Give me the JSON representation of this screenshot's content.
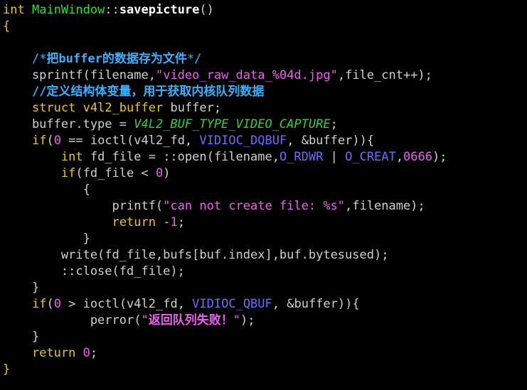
{
  "colors": {
    "background": "#000000",
    "keyword": "#eac32d",
    "function": "#2ee02e",
    "string": "#ee5ef0",
    "macro": "#6d6dff",
    "comment": "#39b1ff",
    "text": "#d0d0d0"
  },
  "code": {
    "lines": [
      [
        {
          "t": "int",
          "c": "kw"
        },
        {
          "t": " ",
          "c": "ident"
        },
        {
          "t": "MainWindow",
          "c": "fn"
        },
        {
          "t": "::",
          "c": "op"
        },
        {
          "t": "savepicture",
          "c": "fnbold"
        },
        {
          "t": "()",
          "c": "punct"
        }
      ],
      [
        {
          "t": "{",
          "c": "kw"
        }
      ],
      [],
      [
        {
          "t": "    ",
          "c": "ident"
        },
        {
          "t": "/*",
          "c": "comment"
        },
        {
          "t": "把buffer的数据存为文件",
          "c": "commentbold"
        },
        {
          "t": "*/",
          "c": "comment"
        }
      ],
      [
        {
          "t": "    sprintf",
          "c": "ident"
        },
        {
          "t": "(",
          "c": "punct"
        },
        {
          "t": "filename,",
          "c": "ident"
        },
        {
          "t": "\"video_raw_data_%04d.jpg\"",
          "c": "str"
        },
        {
          "t": ",file_cnt++);",
          "c": "ident"
        }
      ],
      [
        {
          "t": "    ",
          "c": "ident"
        },
        {
          "t": "//定义结构体变量，用于获取内核队列数据",
          "c": "commentbold"
        }
      ],
      [
        {
          "t": "    ",
          "c": "ident"
        },
        {
          "t": "struct",
          "c": "kw"
        },
        {
          "t": " ",
          "c": "ident"
        },
        {
          "t": "v4l2_buffer",
          "c": "kw"
        },
        {
          "t": " buffer;",
          "c": "ident"
        }
      ],
      [
        {
          "t": "    buffer.type = ",
          "c": "ident"
        },
        {
          "t": "V4L2_BUF_TYPE_VIDEO_CAPTURE",
          "c": "macro2"
        },
        {
          "t": ";",
          "c": "ident"
        }
      ],
      [
        {
          "t": "    ",
          "c": "ident"
        },
        {
          "t": "if",
          "c": "kw"
        },
        {
          "t": "(",
          "c": "punct"
        },
        {
          "t": "0",
          "c": "num"
        },
        {
          "t": " == ioctl(v4l2_fd, ",
          "c": "ident"
        },
        {
          "t": "VIDIOC_DQBUF",
          "c": "macro"
        },
        {
          "t": ", &buffer)){",
          "c": "ident"
        }
      ],
      [
        {
          "t": "        ",
          "c": "ident"
        },
        {
          "t": "int",
          "c": "kw"
        },
        {
          "t": " fd_file = ::open(filename,",
          "c": "ident"
        },
        {
          "t": "O_RDWR",
          "c": "macro"
        },
        {
          "t": " | ",
          "c": "ident"
        },
        {
          "t": "O_CREAT",
          "c": "macro"
        },
        {
          "t": ",",
          "c": "ident"
        },
        {
          "t": "0666",
          "c": "num"
        },
        {
          "t": ");",
          "c": "ident"
        }
      ],
      [
        {
          "t": "        ",
          "c": "ident"
        },
        {
          "t": "if",
          "c": "kw"
        },
        {
          "t": "(fd_file < ",
          "c": "ident"
        },
        {
          "t": "0",
          "c": "num"
        },
        {
          "t": ")",
          "c": "ident"
        }
      ],
      [
        {
          "t": "           {",
          "c": "ident"
        }
      ],
      [
        {
          "t": "               printf(",
          "c": "ident"
        },
        {
          "t": "\"can not create file: %s\"",
          "c": "str"
        },
        {
          "t": ",filename);",
          "c": "ident"
        }
      ],
      [
        {
          "t": "               ",
          "c": "ident"
        },
        {
          "t": "return",
          "c": "kw"
        },
        {
          "t": " -",
          "c": "ident"
        },
        {
          "t": "1",
          "c": "num"
        },
        {
          "t": ";",
          "c": "ident"
        }
      ],
      [
        {
          "t": "           }",
          "c": "ident"
        }
      ],
      [
        {
          "t": "        write(fd_file,bufs[buf.index],buf.bytesused);",
          "c": "ident"
        }
      ],
      [
        {
          "t": "        ::close(fd_file);",
          "c": "ident"
        }
      ],
      [
        {
          "t": "    }",
          "c": "ident"
        }
      ],
      [
        {
          "t": "    ",
          "c": "ident"
        },
        {
          "t": "if",
          "c": "kw"
        },
        {
          "t": "(",
          "c": "punct"
        },
        {
          "t": "0",
          "c": "num"
        },
        {
          "t": " > ioctl(v4l2_fd, ",
          "c": "ident"
        },
        {
          "t": "VIDIOC_QBUF",
          "c": "macro"
        },
        {
          "t": ", &buffer)){",
          "c": "ident"
        }
      ],
      [
        {
          "t": "            perror(",
          "c": "ident"
        },
        {
          "t": "\"",
          "c": "str"
        },
        {
          "t": "返回队列失败！",
          "c": "strbold"
        },
        {
          "t": "\"",
          "c": "str"
        },
        {
          "t": ");",
          "c": "ident"
        }
      ],
      [
        {
          "t": "    }",
          "c": "ident"
        }
      ],
      [
        {
          "t": "    ",
          "c": "ident"
        },
        {
          "t": "return",
          "c": "kw"
        },
        {
          "t": " ",
          "c": "ident"
        },
        {
          "t": "0",
          "c": "num"
        },
        {
          "t": ";",
          "c": "ident"
        }
      ],
      [
        {
          "t": "}",
          "c": "kw"
        }
      ]
    ]
  }
}
